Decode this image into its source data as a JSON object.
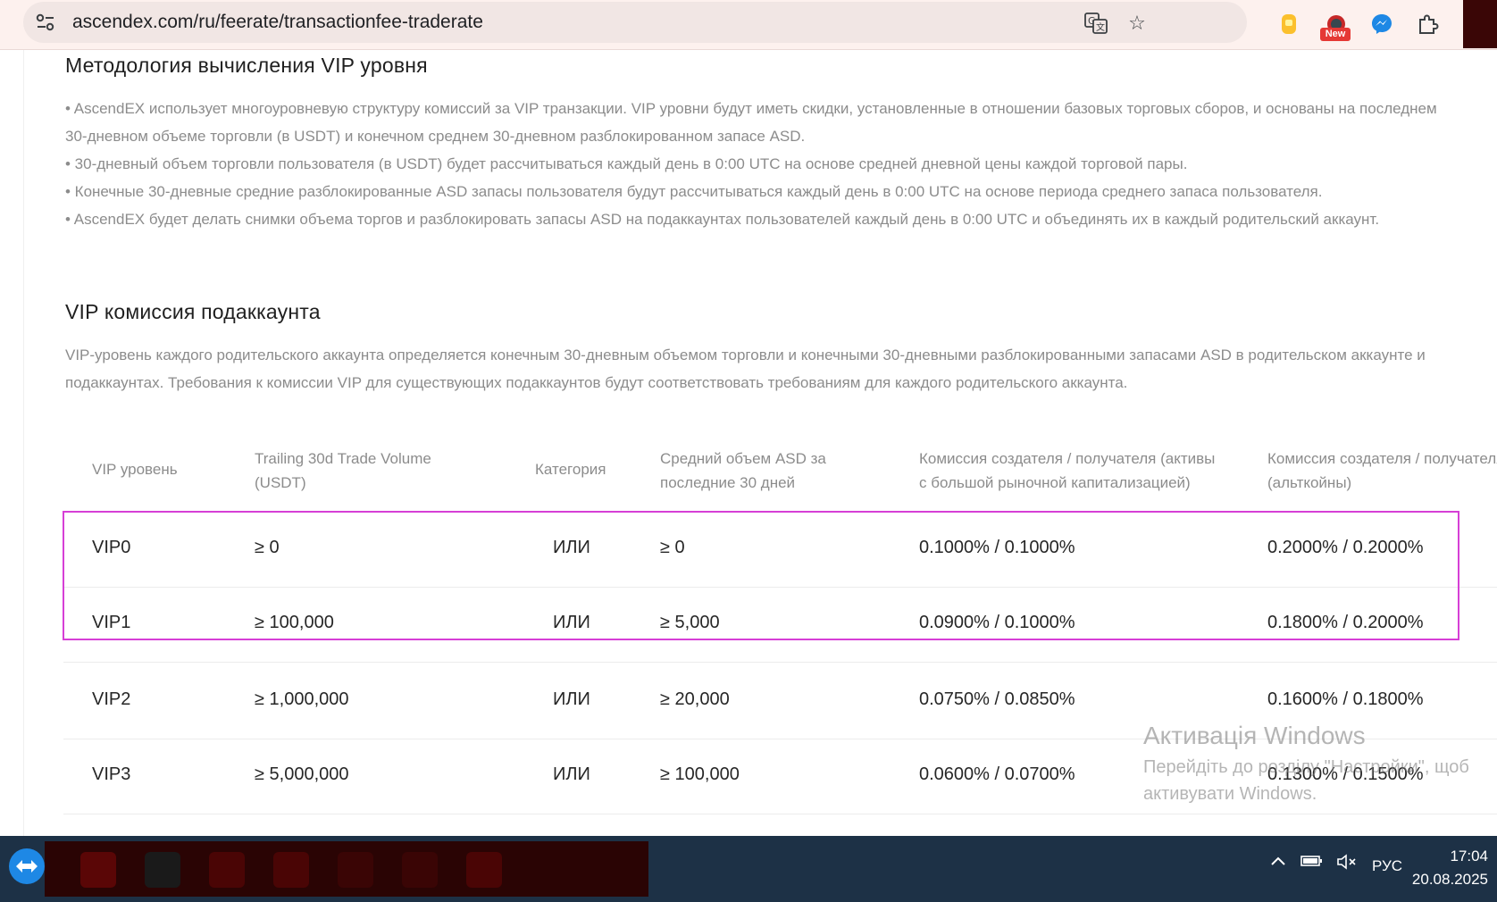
{
  "browser": {
    "url": "ascendex.com/ru/feerate/transactionfee-traderate",
    "extension_badge": "New",
    "icons": [
      "site-info-icon",
      "translate-icon",
      "bookmark-star-icon",
      "extension-yellow-icon",
      "extension-new-icon",
      "messenger-icon",
      "puzzle-extensions-icon"
    ]
  },
  "section1": {
    "title": "Методология вычисления VIP уровня",
    "lines": [
      "• AscendEX использует многоуровневую структуру комиссий за VIP транзакции. VIP уровни будут иметь скидки, установленные в отношении базовых торговых сборов, и основаны на последнем",
      "30-дневном объеме торговли (в USDT) и конечном среднем 30-дневном разблокированном запасе ASD.",
      "• 30-дневный объем торговли пользователя (в USDT) будет рассчитываться каждый день в 0:00 UTC на основе средней дневной цены каждой торговой пары.",
      "• Конечные 30-дневные средние разблокированные ASD запасы пользователя будут рассчитываться каждый день в 0:00 UTC на основе периода среднего запаса пользователя.",
      "• AscendEX будет делать снимки объема торгов и разблокировать запасы ASD на подаккаунтах пользователей каждый день в 0:00 UTC и объединять их в каждый родительский аккаунт."
    ]
  },
  "section2": {
    "title": "VIP комиссия подаккаунта",
    "lines": [
      "VIP-уровень каждого родительского аккаунта определяется конечным 30-дневным объемом торговли и конечными 30-дневными разблокированными запасами ASD в родительском аккаунте и",
      "подаккаунтах. Требования к комиссии VIP для существующих подаккаунтов будут соответствовать требованиям для каждого родительского аккаунта."
    ]
  },
  "table": {
    "headers": {
      "level": "VIP уровень",
      "volume_1": "Trailing 30d Trade Volume",
      "volume_2": "(USDT)",
      "category": "Категория",
      "asd_1": "Средний объем ASD за",
      "asd_2": "последние 30 дней",
      "fee_big_1": "Комиссия создателя / получателя (активы",
      "fee_big_2": "с большой рыночной капитализацией)",
      "fee_alt_1": "Комиссия создателя / получателя",
      "fee_alt_2": "(альткойны)"
    },
    "rows": [
      {
        "level": "VIP0",
        "volume": "≥ 0",
        "category": "ИЛИ",
        "asd": "≥ 0",
        "fee_big": "0.1000% / 0.1000%",
        "fee_alt": "0.2000% / 0.2000%"
      },
      {
        "level": "VIP1",
        "volume": "≥ 100,000",
        "category": "ИЛИ",
        "asd": "≥ 5,000",
        "fee_big": "0.0900% / 0.1000%",
        "fee_alt": "0.1800% / 0.2000%"
      },
      {
        "level": "VIP2",
        "volume": "≥ 1,000,000",
        "category": "ИЛИ",
        "asd": "≥ 20,000",
        "fee_big": "0.0750% / 0.0850%",
        "fee_alt": "0.1600% / 0.1800%"
      },
      {
        "level": "VIP3",
        "volume": "≥ 5,000,000",
        "category": "ИЛИ",
        "asd": "≥ 100,000",
        "fee_big": "0.0600% / 0.0700%",
        "fee_alt": "0.1300% / 0.1500%"
      }
    ]
  },
  "watermark": {
    "title": "Активація Windows",
    "line1": "Перейдіть до розділу \"Настройки\", щоб",
    "line2": "активувати Windows."
  },
  "taskbar": {
    "lang": "РУС",
    "time": "17:04",
    "date": "20.08.2025"
  },
  "colors": {
    "toolbar_bg": "#fdf1ee",
    "highlight": "#d63fd6",
    "taskbar_bg": "#1d3146"
  }
}
